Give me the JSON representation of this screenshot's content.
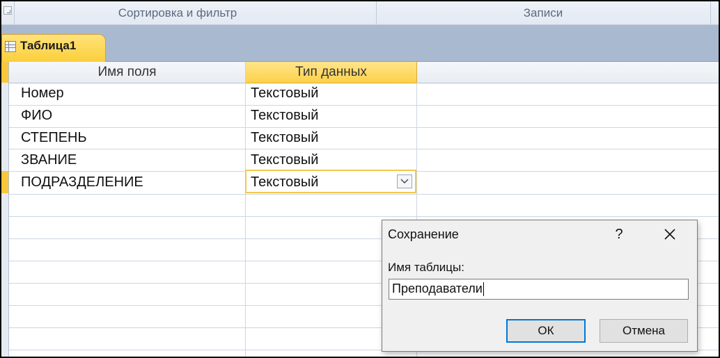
{
  "ribbon": {
    "group_sort_filter": "Сортировка и фильтр",
    "group_records": "Записи"
  },
  "tab": {
    "label": "Таблица1"
  },
  "table": {
    "columns": [
      "Имя поля",
      "Тип данных"
    ],
    "rows": [
      {
        "field": "Номер",
        "type": "Текстовый"
      },
      {
        "field": "ФИО",
        "type": "Текстовый"
      },
      {
        "field": "СТЕПЕНЬ",
        "type": "Текстовый"
      },
      {
        "field": "ЗВАНИЕ",
        "type": "Текстовый"
      },
      {
        "field": "ПОДРАЗДЕЛЕНИЕ",
        "type": "Текстовый"
      }
    ]
  },
  "dialog": {
    "title": "Сохранение",
    "help": "?",
    "label": "Имя таблицы:",
    "input_value": "Преподаватели",
    "ok": "ОК",
    "cancel": "Отмена"
  },
  "colors": {
    "accent": "#fcd14a",
    "focus": "#0078d7"
  }
}
